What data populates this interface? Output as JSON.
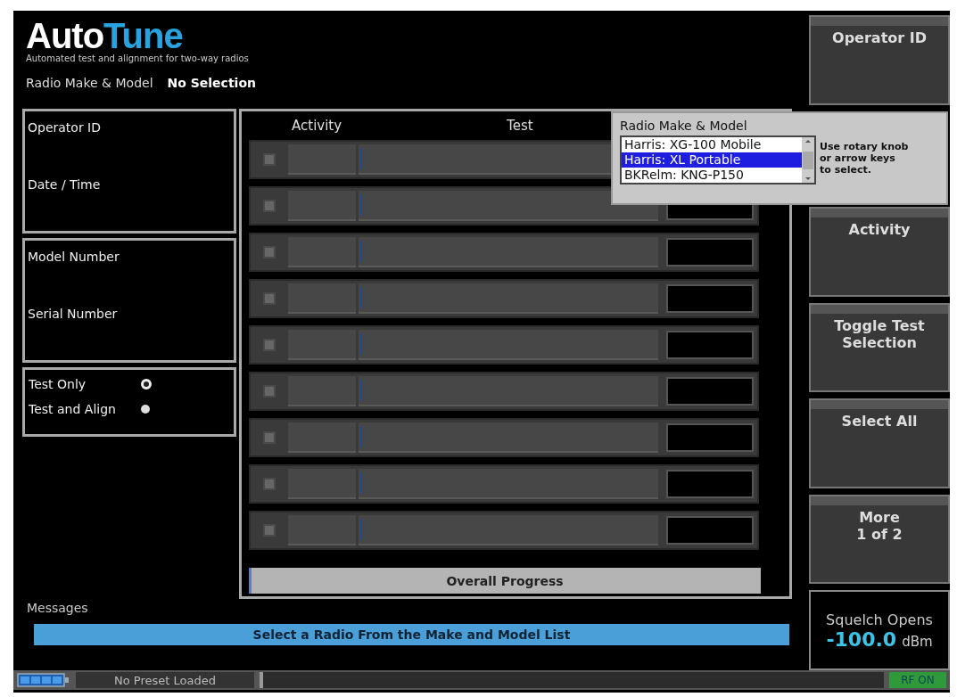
{
  "header": {
    "logo_primary": "Auto",
    "logo_accent": "Tune",
    "subtitle": "Automated test and alignment for two-way radios",
    "radio_label": "Radio Make & Model",
    "radio_value": "No Selection"
  },
  "info_panels": [
    {
      "fields": [
        "Operator ID",
        "Date / Time"
      ]
    },
    {
      "fields": [
        "Model Number",
        "Serial Number"
      ]
    }
  ],
  "test_mode": [
    {
      "label": "Test Only",
      "selected": true
    },
    {
      "label": "Test and Align",
      "selected": false
    }
  ],
  "table": {
    "columns": [
      "Activity",
      "Test"
    ],
    "rows": [
      {
        "checked": false
      },
      {
        "checked": false
      },
      {
        "checked": false
      },
      {
        "checked": false
      },
      {
        "checked": false
      },
      {
        "checked": false
      },
      {
        "checked": false
      },
      {
        "checked": false
      },
      {
        "checked": false
      }
    ]
  },
  "overall_progress": {
    "label": "Overall Progress",
    "level": 0.005
  },
  "messages": {
    "label": "Messages",
    "text": "Select a Radio From the Make and Model List"
  },
  "popup": {
    "title": "Radio Make & Model",
    "options": [
      {
        "label": "Harris: XG-100 Mobile",
        "selected": false
      },
      {
        "label": "Harris: XL Portable",
        "selected": true
      },
      {
        "label": "BKRelm: KNG-P150",
        "selected": false
      }
    ],
    "hint": "Use rotary knob or arrow keys to select."
  },
  "softkeys": [
    {
      "label": "Operator ID"
    },
    {
      "label": "Activity"
    },
    {
      "label": "Toggle Test\nSelection"
    },
    {
      "label": "Select All"
    },
    {
      "label": "More\n1 of 2"
    }
  ],
  "squelch": {
    "label": "Squelch Opens",
    "value": "-100.0",
    "unit": "dBm"
  },
  "status_bar": {
    "preset": "No Preset Loaded",
    "rf": "RF ON"
  }
}
